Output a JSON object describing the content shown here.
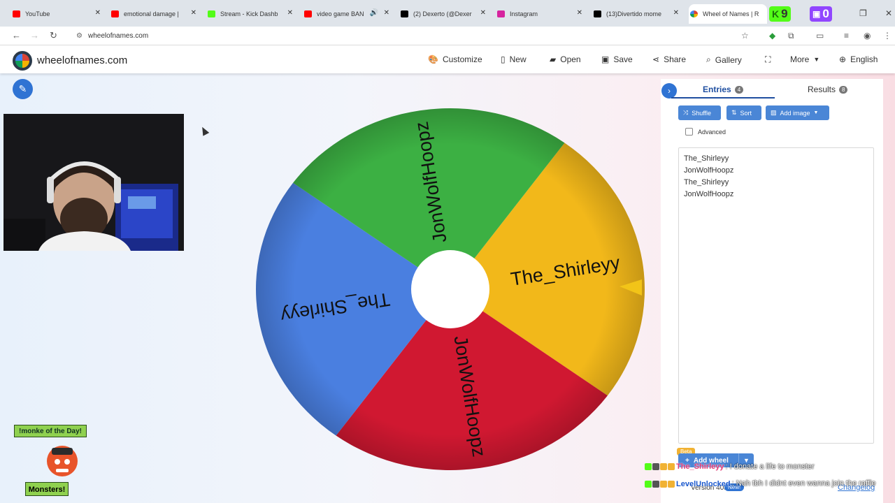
{
  "browser": {
    "tabs": [
      {
        "title": "YouTube",
        "icon": "youtube-icon",
        "color": "#ff0000"
      },
      {
        "title": "emotional damage |",
        "icon": "youtube-icon",
        "color": "#ff0000"
      },
      {
        "title": "Stream - Kick Dashb",
        "icon": "kick-icon",
        "color": "#53fc18"
      },
      {
        "title": "video game BAN",
        "icon": "youtube-icon",
        "color": "#ff0000"
      },
      {
        "title": "(2) Dexerto (@Dexer",
        "icon": "x-icon",
        "color": "#000000"
      },
      {
        "title": "Instagram",
        "icon": "instagram-icon",
        "color": "#d6249f"
      },
      {
        "title": "(13)Divertido mome",
        "icon": "tiktok-icon",
        "color": "#000000"
      },
      {
        "title": "Wheel of Names | R",
        "icon": "wheelofnames-icon",
        "color": "#4285f4"
      }
    ],
    "kick_count": "9",
    "twitch_count": "0",
    "url": "wheelofnames.com"
  },
  "app": {
    "brand": "wheelofnames.com",
    "menu": [
      {
        "label": "Customize",
        "icon": "palette-icon"
      },
      {
        "label": "New",
        "icon": "file-icon"
      },
      {
        "label": "Open",
        "icon": "folder-icon"
      },
      {
        "label": "Save",
        "icon": "save-icon"
      },
      {
        "label": "Share",
        "icon": "share-icon"
      },
      {
        "label": "Gallery",
        "icon": "search-icon"
      },
      {
        "label": "",
        "icon": "fullscreen-icon"
      },
      {
        "label": "More",
        "icon": "chevron-down-icon"
      },
      {
        "label": "English",
        "icon": "globe-icon"
      }
    ]
  },
  "wheel": {
    "segments": [
      {
        "label": "The_Shirleyy",
        "color": "#f2b81a"
      },
      {
        "label": "JonWolfHoopz",
        "color": "#d01831"
      },
      {
        "label": "The_Shirleyy",
        "color": "#4a7fe0"
      },
      {
        "label": "JonWolfHoopz",
        "color": "#3cb043"
      }
    ],
    "pointer_color": "#f2c418"
  },
  "panel": {
    "entries_tab": "Entries",
    "entries_count": "4",
    "results_tab": "Results",
    "results_count": "8",
    "shuffle": "Shuffle",
    "sort": "Sort",
    "add_image": "Add image",
    "advanced": "Advanced",
    "entries": [
      "The_Shirleyy",
      "JonWolfHoopz",
      "The_Shirleyy",
      "JonWolfHoopz"
    ]
  },
  "footer": {
    "beta": "Beta",
    "add_wheel": "Add wheel",
    "version": "Version 405",
    "new_badge": "New!",
    "changelog": "Changelog"
  },
  "chat": [
    {
      "user": "The_Shirleyy",
      "message": ": I donate a life to monster"
    },
    {
      "user": "LevelUnlocked",
      "message": ": Nah tbh I didnt even wanna join the raffle"
    }
  ],
  "overlay": {
    "monke_title": "!monke of the Day!",
    "monsters": "Monsters!"
  }
}
